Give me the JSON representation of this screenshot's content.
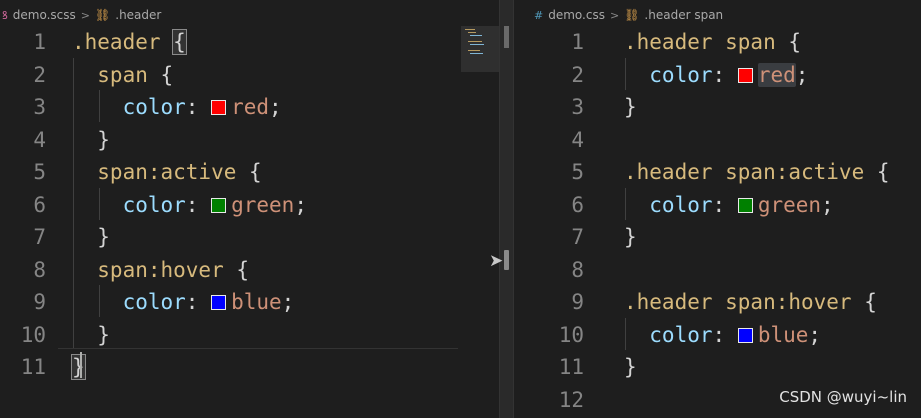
{
  "left_editor": {
    "file_name": "demo.scss",
    "symbol": ".header",
    "lines": [
      {
        "n": "1",
        "tokens": [
          {
            "t": ".header",
            "c": "sel"
          },
          {
            "t": " ",
            "c": "punct"
          },
          {
            "t": "{",
            "c": "punct",
            "hl": "brace-match"
          }
        ]
      },
      {
        "n": "2",
        "tokens": [
          {
            "t": "  span",
            "c": "sel"
          },
          {
            "t": " {",
            "c": "punct"
          }
        ]
      },
      {
        "n": "3",
        "tokens": [
          {
            "t": "    color",
            "c": "prop"
          },
          {
            "t": ": ",
            "c": "punct"
          },
          {
            "swatch": "#ff0000"
          },
          {
            "t": "red",
            "c": "val"
          },
          {
            "t": ";",
            "c": "punct"
          }
        ]
      },
      {
        "n": "4",
        "tokens": [
          {
            "t": "  }",
            "c": "punct"
          }
        ]
      },
      {
        "n": "5",
        "tokens": [
          {
            "t": "  span:active",
            "c": "sel"
          },
          {
            "t": " {",
            "c": "punct"
          }
        ]
      },
      {
        "n": "6",
        "tokens": [
          {
            "t": "    color",
            "c": "prop"
          },
          {
            "t": ": ",
            "c": "punct"
          },
          {
            "swatch": "#008000"
          },
          {
            "t": "green",
            "c": "val"
          },
          {
            "t": ";",
            "c": "punct"
          }
        ]
      },
      {
        "n": "7",
        "tokens": [
          {
            "t": "  }",
            "c": "punct"
          }
        ]
      },
      {
        "n": "8",
        "tokens": [
          {
            "t": "  span:hover",
            "c": "sel"
          },
          {
            "t": " {",
            "c": "punct"
          }
        ]
      },
      {
        "n": "9",
        "tokens": [
          {
            "t": "    color",
            "c": "prop"
          },
          {
            "t": ": ",
            "c": "punct"
          },
          {
            "swatch": "#0000ff"
          },
          {
            "t": "blue",
            "c": "val"
          },
          {
            "t": ";",
            "c": "punct"
          }
        ]
      },
      {
        "n": "10",
        "tokens": [
          {
            "t": "  }",
            "c": "punct"
          }
        ]
      },
      {
        "n": "11",
        "tokens": [
          {
            "t": "}",
            "c": "punct",
            "hl": "brace-match"
          }
        ]
      }
    ]
  },
  "right_editor": {
    "file_name": "demo.css",
    "symbol": ".header span",
    "lines": [
      {
        "n": "1",
        "tokens": [
          {
            "t": ".header span",
            "c": "sel"
          },
          {
            "t": " {",
            "c": "punct"
          }
        ]
      },
      {
        "n": "2",
        "tokens": [
          {
            "t": "  color",
            "c": "prop"
          },
          {
            "t": ": ",
            "c": "punct"
          },
          {
            "swatch": "#ff0000"
          },
          {
            "t": "red",
            "c": "val",
            "hl": "word-hl"
          },
          {
            "t": ";",
            "c": "punct"
          }
        ]
      },
      {
        "n": "3",
        "tokens": [
          {
            "t": "}",
            "c": "punct"
          }
        ]
      },
      {
        "n": "4",
        "tokens": []
      },
      {
        "n": "5",
        "tokens": [
          {
            "t": ".header span:active",
            "c": "sel"
          },
          {
            "t": " {",
            "c": "punct"
          }
        ]
      },
      {
        "n": "6",
        "tokens": [
          {
            "t": "  color",
            "c": "prop"
          },
          {
            "t": ": ",
            "c": "punct"
          },
          {
            "swatch": "#008000"
          },
          {
            "t": "green",
            "c": "val"
          },
          {
            "t": ";",
            "c": "punct"
          }
        ]
      },
      {
        "n": "7",
        "tokens": [
          {
            "t": "}",
            "c": "punct"
          }
        ]
      },
      {
        "n": "8",
        "tokens": []
      },
      {
        "n": "9",
        "tokens": [
          {
            "t": ".header span:hover",
            "c": "sel"
          },
          {
            "t": " {",
            "c": "punct"
          }
        ]
      },
      {
        "n": "10",
        "tokens": [
          {
            "t": "  color",
            "c": "prop"
          },
          {
            "t": ": ",
            "c": "punct"
          },
          {
            "swatch": "#0000ff"
          },
          {
            "t": "blue",
            "c": "val"
          },
          {
            "t": ";",
            "c": "punct"
          }
        ]
      },
      {
        "n": "11",
        "tokens": [
          {
            "t": "}",
            "c": "punct"
          }
        ]
      },
      {
        "n": "12",
        "tokens": []
      }
    ]
  },
  "icons": {
    "scss_file": "scss-file-icon",
    "css_file": "css-file-icon",
    "symbol": "symbol-class-icon",
    "separator": "chevron-right-icon"
  },
  "colors": {
    "editor_bg": "#1e1e1e",
    "selector": "#d7ba7d",
    "property": "#9cdcfe",
    "value": "#ce9178",
    "line_number": "#858585"
  },
  "watermark": "CSDN @wuyi~lin"
}
